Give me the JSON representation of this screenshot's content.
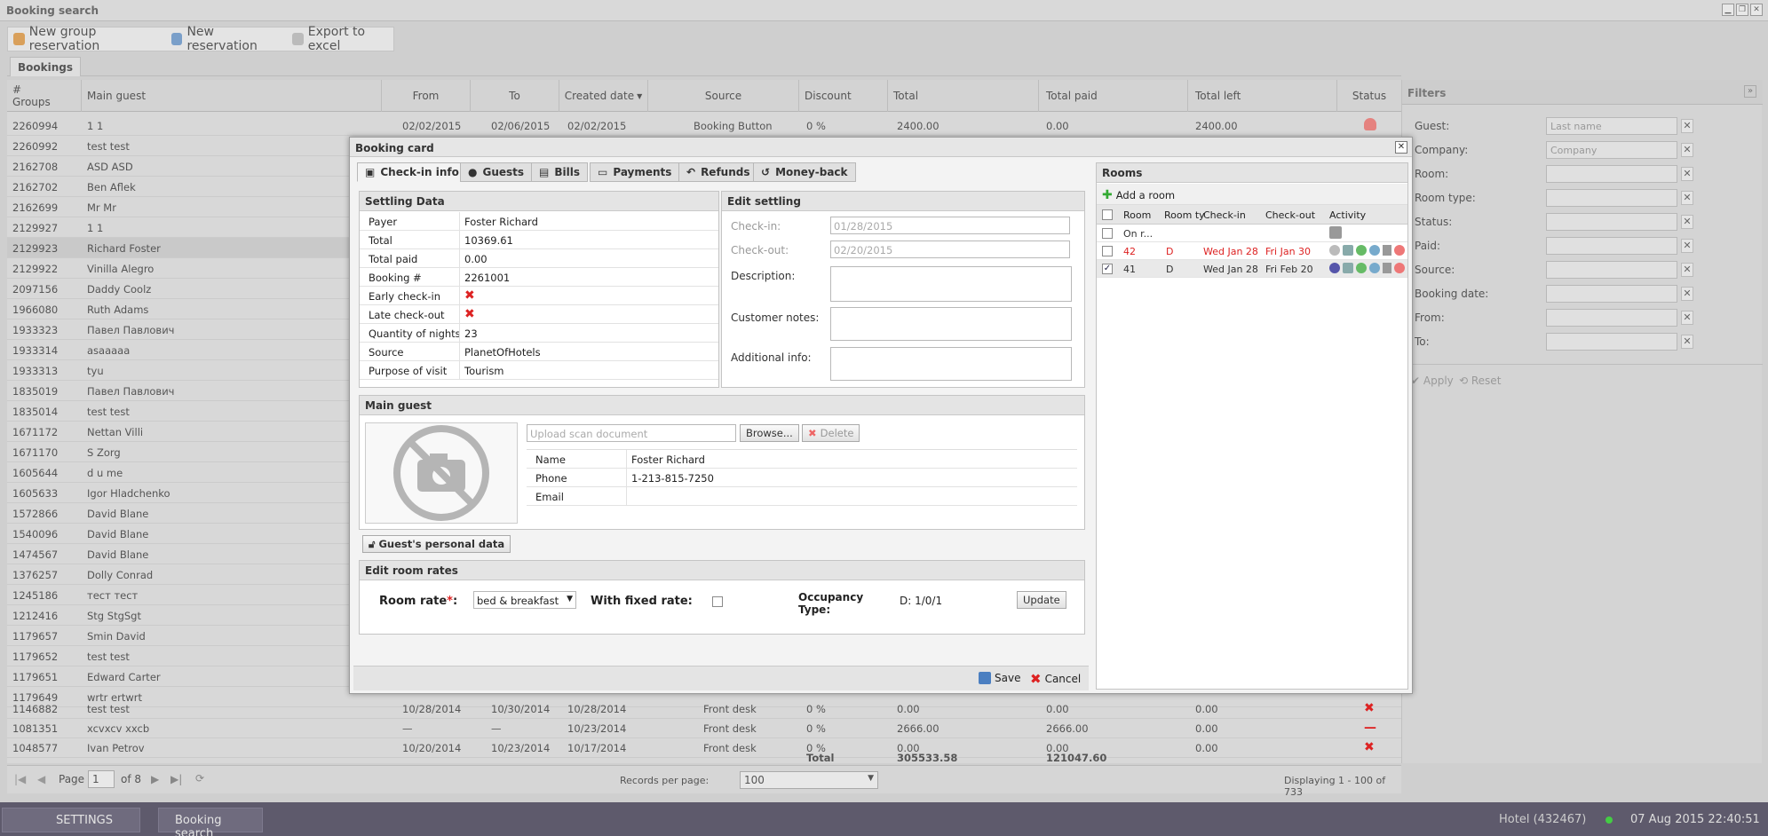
{
  "window": {
    "title": "Booking search"
  },
  "toolbar": {
    "new_group": "New group reservation",
    "new_res": "New reservation",
    "export": "Export to excel"
  },
  "tabs": {
    "bookings": "Bookings"
  },
  "grid": {
    "headers": {
      "groups_hash": "#",
      "groups": "Groups",
      "main_guest": "Main guest",
      "from": "From",
      "to": "To",
      "created": "Created date",
      "source": "Source",
      "discount": "Discount",
      "total": "Total",
      "total_paid": "Total paid",
      "total_left": "Total left",
      "status": "Status"
    },
    "top_row": {
      "id": "2260994",
      "guest": "1 1",
      "from": "02/02/2015",
      "to": "02/06/2015",
      "created": "02/02/2015",
      "source": "Booking Button",
      "discount": "0 %",
      "total": "2400.00",
      "paid": "0.00",
      "left": "2400.00"
    },
    "rows": [
      {
        "id": "2260992",
        "guest": "test test"
      },
      {
        "id": "2162708",
        "guest": "ASD ASD"
      },
      {
        "id": "2162702",
        "guest": "Ben Aflek"
      },
      {
        "id": "2162699",
        "guest": "Mr Mr"
      },
      {
        "id": "2129927",
        "guest": "1 1"
      },
      {
        "id": "2129923",
        "guest": "Richard Foster"
      },
      {
        "id": "2129922",
        "guest": "Vinilla Alegro"
      },
      {
        "id": "2097156",
        "guest": "Daddy Coolz"
      },
      {
        "id": "1966080",
        "guest": "Ruth Adams"
      },
      {
        "id": "1933323",
        "guest": "Павел Павлович"
      },
      {
        "id": "1933314",
        "guest": "asaaaaa"
      },
      {
        "id": "1933313",
        "guest": "tyu"
      },
      {
        "id": "1835019",
        "guest": "Павел Павлович"
      },
      {
        "id": "1835014",
        "guest": "test test"
      },
      {
        "id": "1671172",
        "guest": "Nettan Villi"
      },
      {
        "id": "1671170",
        "guest": "S Zorg"
      },
      {
        "id": "1605644",
        "guest": "d u me"
      },
      {
        "id": "1605633",
        "guest": "Igor Hladchenko"
      },
      {
        "id": "1572866",
        "guest": "David Blane"
      },
      {
        "id": "1540096",
        "guest": "David Blane"
      },
      {
        "id": "1474567",
        "guest": "David Blane"
      },
      {
        "id": "1376257",
        "guest": "Dolly Conrad"
      },
      {
        "id": "1245186",
        "guest": "тест тест"
      },
      {
        "id": "1212416",
        "guest": "Stg StgSgt"
      },
      {
        "id": "1179657",
        "guest": "Smin David"
      },
      {
        "id": "1179652",
        "guest": "test test"
      },
      {
        "id": "1179651",
        "guest": "Edward Carter"
      },
      {
        "id": "1179649",
        "guest": "wrtr ertwrt"
      }
    ],
    "bottom_rows": [
      {
        "id": "1146882",
        "guest": "test test",
        "from": "10/28/2014",
        "to": "10/30/2014",
        "created": "10/28/2014",
        "source": "Front desk",
        "discount": "0 %",
        "total": "0.00",
        "paid": "0.00",
        "left": "0.00",
        "status": "✖"
      },
      {
        "id": "1081351",
        "guest": "xcvxcv xxcb",
        "from": "—",
        "to": "—",
        "created": "10/23/2014",
        "source": "Front desk",
        "discount": "0 %",
        "total": "2666.00",
        "paid": "2666.00",
        "left": "0.00",
        "status": "—"
      },
      {
        "id": "1048577",
        "guest": "Ivan Petrov",
        "from": "10/20/2014",
        "to": "10/23/2014",
        "created": "10/17/2014",
        "source": "Front desk",
        "discount": "0 %",
        "total": "0.00",
        "paid": "0.00",
        "left": "0.00",
        "status": "✖"
      }
    ],
    "totals": {
      "label": "Total",
      "total": "305533.58",
      "paid": "121047.60"
    }
  },
  "pager": {
    "page_label": "Page",
    "page": "1",
    "of": "of 8",
    "records_label": "Records per page:",
    "per_page": "100",
    "displaying": "Displaying 1 - 100 of 733"
  },
  "filters": {
    "title": "Filters",
    "guest": "Guest:",
    "guest_ph": "Last name",
    "company": "Company:",
    "company_ph": "Company",
    "room": "Room:",
    "room_type": "Room type:",
    "status": "Status:",
    "paid": "Paid:",
    "source": "Source:",
    "booking_date": "Booking date:",
    "from": "From:",
    "to": "To:",
    "apply": "Apply",
    "reset": "Reset"
  },
  "taskbar": {
    "settings": "SETTINGS",
    "booking_search": "Booking search",
    "hotel": "Hotel (432467)",
    "datetime": "07 Aug 2015 22:40:51"
  },
  "modal": {
    "title": "Booking card",
    "tabs": [
      "Check-in info",
      "Guests",
      "Bills",
      "Payments",
      "Refunds",
      "Money-back"
    ],
    "settling": {
      "title": "Settling Data",
      "rows": [
        {
          "k": "Payer",
          "v": "Foster Richard"
        },
        {
          "k": "Total",
          "v": "10369.61"
        },
        {
          "k": "Total paid",
          "v": "0.00"
        },
        {
          "k": "Booking #",
          "v": "2261001"
        },
        {
          "k": "Early check-in",
          "v": "✖"
        },
        {
          "k": "Late check-out",
          "v": "✖"
        },
        {
          "k": "Quantity of nights",
          "v": "23"
        },
        {
          "k": "Source",
          "v": "PlanetOfHotels"
        },
        {
          "k": "Purpose of visit",
          "v": "Tourism"
        }
      ]
    },
    "edit_settling": {
      "title": "Edit settling",
      "checkin": "Check-in:",
      "checkin_val": "01/28/2015",
      "checkout": "Check-out:",
      "checkout_val": "02/20/2015",
      "description": "Description:",
      "customer_notes": "Customer notes:",
      "additional": "Additional info:"
    },
    "main_guest": {
      "title": "Main guest",
      "upload_ph": "Upload scan document",
      "browse": "Browse...",
      "delete": "Delete",
      "name_k": "Name",
      "name_v": "Foster Richard",
      "phone_k": "Phone",
      "phone_v": "1-213-815-7250",
      "email_k": "Email",
      "email_v": "",
      "personal": "Guest's personal data"
    },
    "room_rates": {
      "title": "Edit room rates",
      "room_rate": "Room rate",
      "req": "*",
      "colon": ":",
      "rate_val": "bed & breakfast",
      "fixed": "With fixed rate:",
      "occupancy": "Occupancy",
      "occupancy2": "Type:",
      "occ_val": "D: 1/0/1",
      "update": "Update"
    },
    "save": "Save",
    "cancel": "Cancel",
    "rooms": {
      "title": "Rooms",
      "add": "Add a room",
      "headers": {
        "room": "Room",
        "room_type": "Room ty",
        "checkin": "Check-in",
        "checkout": "Check-out",
        "activity": "Activity"
      },
      "rows": [
        {
          "room": "On r...",
          "type": "",
          "in": "",
          "out": "",
          "checked": false,
          "red": false
        },
        {
          "room": "42",
          "type": "D",
          "in": "Wed Jan 28",
          "out": "Fri Jan 30",
          "checked": false,
          "red": true
        },
        {
          "room": "41",
          "type": "D",
          "in": "Wed Jan 28",
          "out": "Fri Feb 20",
          "checked": true,
          "red": false
        }
      ]
    }
  }
}
